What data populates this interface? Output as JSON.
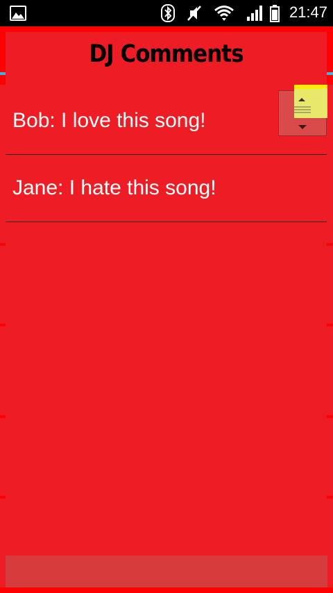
{
  "status_bar": {
    "time": "21:47",
    "icons": [
      "gallery-icon",
      "bluetooth-icon",
      "mute-icon",
      "wifi-icon",
      "signal-icon",
      "battery-icon"
    ]
  },
  "dialog": {
    "title": "DJ Comments",
    "comments": [
      {
        "text": "Bob: I love this song!"
      },
      {
        "text": "Jane: I hate this song!"
      }
    ]
  },
  "colors": {
    "background": "#ff0000",
    "dialog": "#ee1c24",
    "status_bar": "#000000",
    "accent": "#33b5e5",
    "scroll_thumb": "#e8e86a"
  }
}
